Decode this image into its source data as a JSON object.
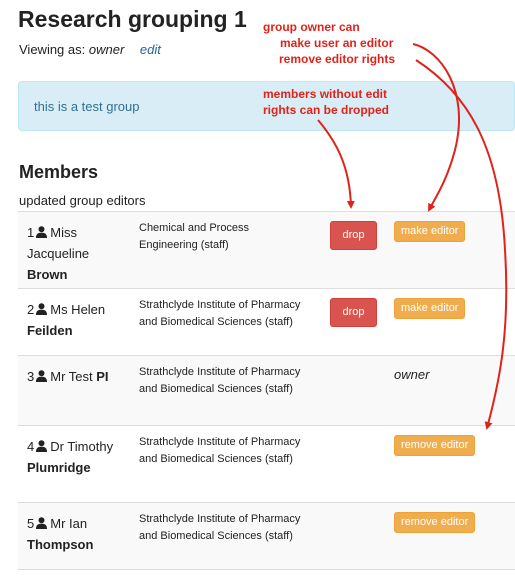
{
  "group": {
    "title": "Research grouping 1",
    "viewing_label": "Viewing as:",
    "viewing_role": "owner",
    "edit_link": "edit",
    "description": "this is a test group"
  },
  "members": {
    "heading": "Members",
    "status": "updated group editors",
    "rows": [
      {
        "number": "1",
        "title_first": "Miss Jacqueline",
        "surname": "Brown",
        "dept": "Chemical and Process Engineering (staff)",
        "drop_label": "drop",
        "action_label": "make editor"
      },
      {
        "number": "2",
        "title_first": "Ms Helen",
        "surname": "Feilden",
        "dept": "Strathclyde Institute of Pharmacy and Biomedical Sciences (staff)",
        "drop_label": "drop",
        "action_label": "make editor"
      },
      {
        "number": "3",
        "title_first": "Mr Test",
        "surname": "PI",
        "dept": "Strathclyde Institute of Pharmacy and Biomedical Sciences (staff)",
        "role_label": "owner"
      },
      {
        "number": "4",
        "title_first": "Dr Timothy",
        "surname": "Plumridge",
        "dept": "Strathclyde Institute of Pharmacy and Biomedical Sciences (staff)",
        "action_label": "remove editor"
      },
      {
        "number": "5",
        "title_first": "Mr Ian",
        "surname": "Thompson",
        "dept": "Strathclyde Institute of Pharmacy and Biomedical Sciences (staff)",
        "action_label": "remove editor"
      }
    ]
  },
  "annotations": {
    "owner_note": [
      "group owner can",
      "make user an editor",
      "remove editor rights"
    ],
    "drop_note": [
      "members without edit",
      "rights can be dropped"
    ]
  },
  "colors": {
    "drop_button": "#d9534f",
    "editor_button": "#f0ad4e",
    "info_box": "#d9edf7",
    "annotation": "#e0231a"
  },
  "icons": {
    "member": "user-icon"
  }
}
